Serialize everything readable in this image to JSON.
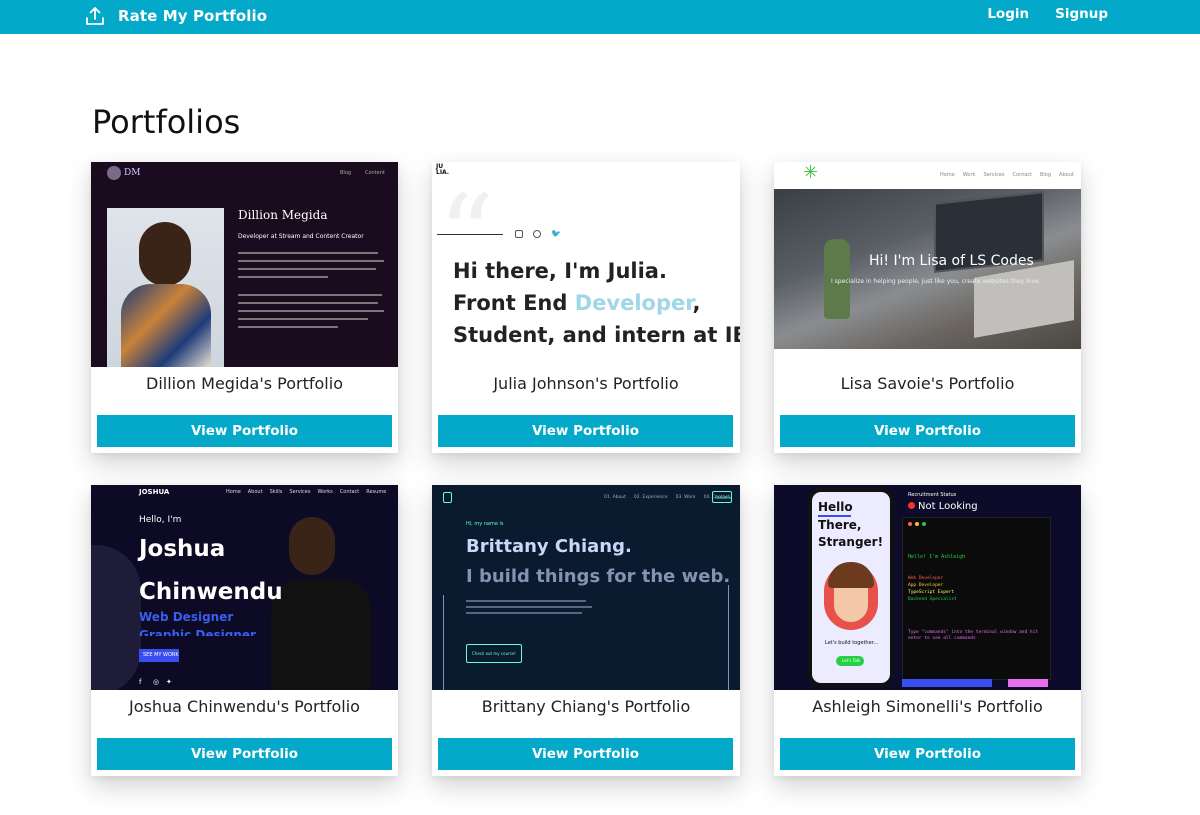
{
  "navbar": {
    "brand": "Rate My Portfolio",
    "brand_icon": "upload-icon",
    "links": [
      "Login",
      "Signup"
    ],
    "color": "#04a9c9"
  },
  "page": {
    "title": "Portfolios"
  },
  "cards": [
    {
      "title": "Dillion Megida's Portfolio",
      "button": "View Portfolio",
      "thumb": {
        "logo": "DM",
        "nav": [
          "Blog",
          "Content"
        ],
        "heading": "Dillion Megida",
        "subtitle": "Developer at Stream and Content Creator"
      }
    },
    {
      "title": "Julia Johnson's Portfolio",
      "button": "View Portfolio",
      "thumb": {
        "logo": "JU LIA.",
        "line1": "Hi there, I'm Julia.",
        "line2a": "Front End ",
        "line2b": "Developer",
        "line2c": ",",
        "line3": "Student, and intern at IBM."
      }
    },
    {
      "title": "Lisa Savoie's Portfolio",
      "button": "View Portfolio",
      "thumb": {
        "nav": [
          "Home",
          "Work",
          "Services",
          "Contact",
          "Blog",
          "About"
        ],
        "heading": "Hi! I'm Lisa of LS Codes",
        "sub": "I specialize in helping people, just like you, create websites they love."
      }
    },
    {
      "title": "Joshua Chinwendu's Portfolio",
      "button": "View Portfolio",
      "thumb": {
        "logo": "JOSHUA",
        "nav": [
          "Home",
          "About",
          "Skills",
          "Services",
          "Works",
          "Contact",
          "Resume"
        ],
        "hello": "Hello, I'm",
        "first": "Joshua",
        "last": "Chinwendu",
        "role1": "Web Designer",
        "role2": "Graphic Designer",
        "cta": "SEE MY WORK"
      }
    },
    {
      "title": "Brittany Chiang's Portfolio",
      "button": "View Portfolio",
      "thumb": {
        "nav": [
          "01. About",
          "02. Experience",
          "03. Work",
          "04. Contact"
        ],
        "resume": "Resume",
        "intro": "Hi, my name is",
        "name": "Brittany Chiang.",
        "tagline": "I build things for the web.",
        "cta": "Check out my course!"
      }
    },
    {
      "title": "Ashleigh Simonelli's Portfolio",
      "button": "View Portfolio",
      "thumb": {
        "phone1": "Hello",
        "phone2": "There,",
        "phone3": "Stranger!",
        "phone_sub": "Let's build together...",
        "phone_btn": "Let's Talk",
        "status_label": "Recruitment Status",
        "status": "Not Looking",
        "term1": "Hello! I'm Ashleigh",
        "skills": [
          "Web Developer",
          "App Developer",
          "TypeScript Expert",
          "Backend Specialist"
        ],
        "term2": "Type \"commands\" into the terminal window and hit enter to see all commands"
      }
    }
  ]
}
